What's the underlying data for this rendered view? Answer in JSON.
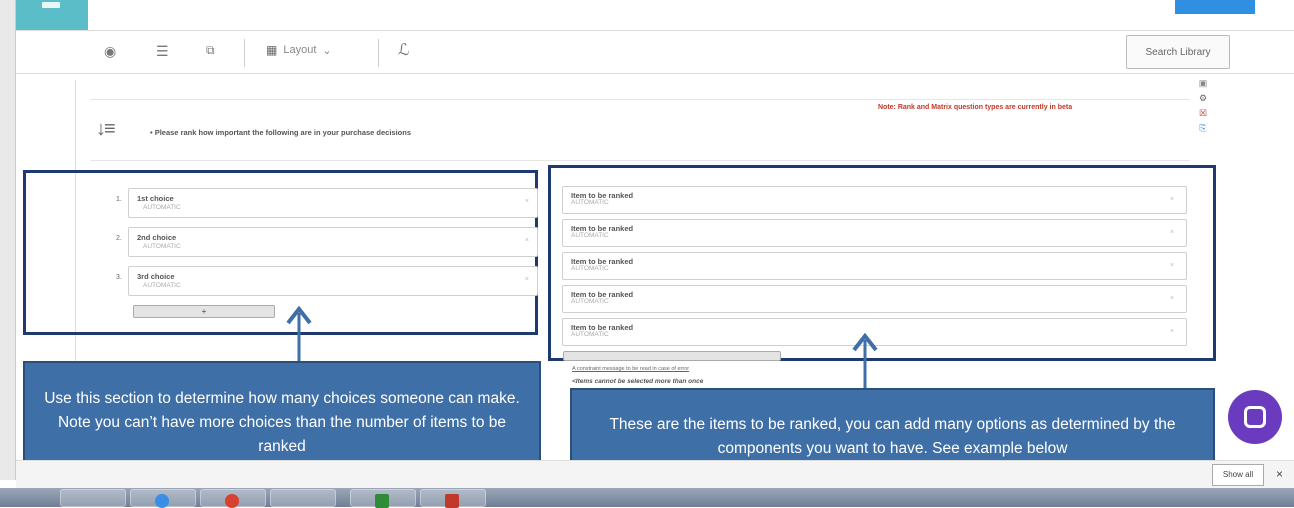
{
  "toolbar": {
    "layout_label": "Layout",
    "search_library_label": "Search Library"
  },
  "question": {
    "note": "Note: Rank and Matrix question types are currently in beta",
    "text": "• Please rank how important the following are in your purchase decisions"
  },
  "choices": [
    {
      "number": "1.",
      "label": "1st choice",
      "sub": "AUTOMATIC"
    },
    {
      "number": "2.",
      "label": "2nd choice",
      "sub": "AUTOMATIC"
    },
    {
      "number": "3.",
      "label": "3rd choice",
      "sub": "AUTOMATIC"
    }
  ],
  "add_choice_label": "+",
  "items": [
    {
      "label": "Item to be ranked",
      "sub": "AUTOMATIC"
    },
    {
      "label": "Item to be ranked",
      "sub": "AUTOMATIC"
    },
    {
      "label": "Item to be ranked",
      "sub": "AUTOMATIC"
    },
    {
      "label": "Item to be ranked",
      "sub": "AUTOMATIC"
    },
    {
      "label": "Item to be ranked",
      "sub": "AUTOMATIC"
    }
  ],
  "constraint": {
    "label": "A constraint message to be read in case of error",
    "message": "<Items cannot be selected more than once"
  },
  "callouts": {
    "left": "Use this section to determine how many choices someone can make. Note you can’t have more choices than the number of items to be ranked",
    "right": "These are the items to be ranked, you can add many options as determined by the components you want to have. See example below"
  },
  "bottom": {
    "show_all": "Show all",
    "close": "×"
  },
  "colors": {
    "callout_bg": "#3f6fa7",
    "box_border": "#1f3a6e",
    "chat": "#6a3bbf",
    "beta_note": "#c0392b"
  },
  "icons": [
    "eye-icon",
    "list-icon",
    "copy-icon",
    "grid-icon",
    "chevron-down-icon",
    "logic-icon",
    "rank-icon",
    "image-icon",
    "gear-icon",
    "trash-icon",
    "copy-side-icon",
    "chat-icon",
    "close-icon"
  ]
}
